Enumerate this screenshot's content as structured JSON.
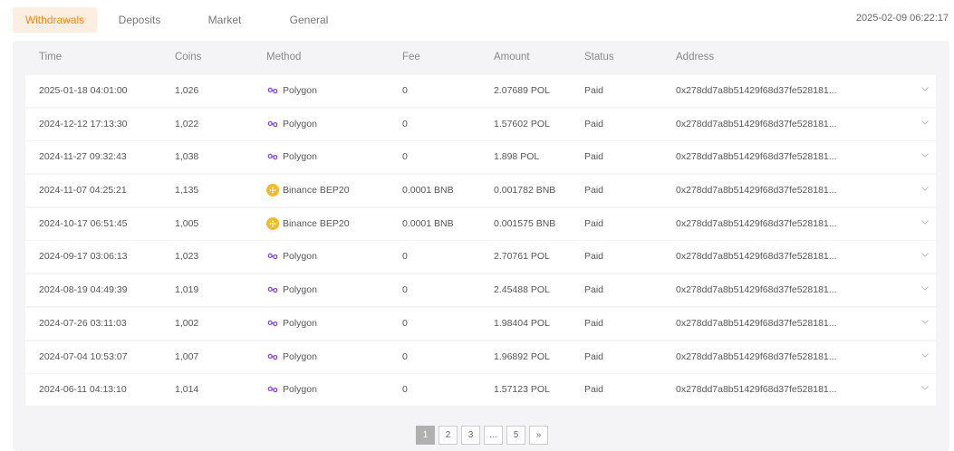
{
  "tabs": [
    "Withdrawals",
    "Deposits",
    "Market",
    "General"
  ],
  "active_tab": 0,
  "timestamp": "2025-02-09 06:22:17",
  "columns": [
    "Time",
    "Coins",
    "Method",
    "Fee",
    "Amount",
    "Status",
    "Address"
  ],
  "rows": [
    {
      "time": "2025-01-18 04:01:00",
      "coins": "1,026",
      "method": "Polygon",
      "method_icon": "polygon-icon",
      "fee": "0",
      "amount": "2.07689 POL",
      "status": "Paid",
      "address": "0x278dd7a8b51429f68d37fe528181..."
    },
    {
      "time": "2024-12-12 17:13:30",
      "coins": "1,022",
      "method": "Polygon",
      "method_icon": "polygon-icon",
      "fee": "0",
      "amount": "1.57602 POL",
      "status": "Paid",
      "address": "0x278dd7a8b51429f68d37fe528181..."
    },
    {
      "time": "2024-11-27 09:32:43",
      "coins": "1,038",
      "method": "Polygon",
      "method_icon": "polygon-icon",
      "fee": "0",
      "amount": "1.898 POL",
      "status": "Paid",
      "address": "0x278dd7a8b51429f68d37fe528181..."
    },
    {
      "time": "2024-11-07 04:25:21",
      "coins": "1,135",
      "method": "Binance BEP20",
      "method_icon": "binance-icon",
      "fee": "0.0001 BNB",
      "amount": "0.001782 BNB",
      "status": "Paid",
      "address": "0x278dd7a8b51429f68d37fe528181..."
    },
    {
      "time": "2024-10-17 06:51:45",
      "coins": "1,005",
      "method": "Binance BEP20",
      "method_icon": "binance-icon",
      "fee": "0.0001 BNB",
      "amount": "0.001575 BNB",
      "status": "Paid",
      "address": "0x278dd7a8b51429f68d37fe528181..."
    },
    {
      "time": "2024-09-17 03:06:13",
      "coins": "1,023",
      "method": "Polygon",
      "method_icon": "polygon-icon",
      "fee": "0",
      "amount": "2.70761 POL",
      "status": "Paid",
      "address": "0x278dd7a8b51429f68d37fe528181..."
    },
    {
      "time": "2024-08-19 04:49:39",
      "coins": "1,019",
      "method": "Polygon",
      "method_icon": "polygon-icon",
      "fee": "0",
      "amount": "2.45488 POL",
      "status": "Paid",
      "address": "0x278dd7a8b51429f68d37fe528181..."
    },
    {
      "time": "2024-07-26 03:11:03",
      "coins": "1,002",
      "method": "Polygon",
      "method_icon": "polygon-icon",
      "fee": "0",
      "amount": "1.98404 POL",
      "status": "Paid",
      "address": "0x278dd7a8b51429f68d37fe528181..."
    },
    {
      "time": "2024-07-04 10:53:07",
      "coins": "1,007",
      "method": "Polygon",
      "method_icon": "polygon-icon",
      "fee": "0",
      "amount": "1.96892 POL",
      "status": "Paid",
      "address": "0x278dd7a8b51429f68d37fe528181..."
    },
    {
      "time": "2024-06-11 04:13:10",
      "coins": "1,014",
      "method": "Polygon",
      "method_icon": "polygon-icon",
      "fee": "0",
      "amount": "1.57123 POL",
      "status": "Paid",
      "address": "0x278dd7a8b51429f68d37fe528181..."
    }
  ],
  "pagination": [
    "1",
    "2",
    "3",
    "...",
    "5",
    "»"
  ],
  "current_page": "1",
  "colors": {
    "accent": "#f28a1c",
    "accent_bg": "#fcefe1",
    "polygon": "#8247e5",
    "binance": "#f3ba2f",
    "panel_bg": "#f4f4f6"
  }
}
